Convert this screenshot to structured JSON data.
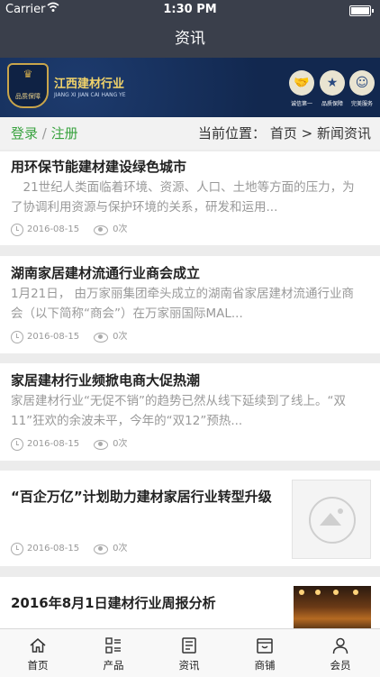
{
  "status_bar": {
    "carrier": "Carrier",
    "time": "1:30 PM"
  },
  "nav": {
    "title": "资讯"
  },
  "banner": {
    "shield_label": "品质保障",
    "brand_title": "江西建材行业",
    "brand_subtitle": "JIANG XI JIAN CAI HANG YE",
    "badges": [
      {
        "icon": "handshake-icon",
        "label": "诚信第一"
      },
      {
        "icon": "star-icon",
        "label": "品质保障"
      },
      {
        "icon": "service-person-icon",
        "label": "完美服务"
      }
    ]
  },
  "breadcrumb_bar": {
    "login": "登录",
    "separator": "/",
    "register": "注册",
    "location_prefix": "当前位置：",
    "home": "首页",
    "arrow": ">",
    "current": "新闻资讯"
  },
  "articles": [
    {
      "title": "用环保节能建材建设绿色城市",
      "summary": "　21世纪人类面临着环境、资源、人口、土地等方面的压力，为了协调利用资源与保护环境的关系，研发和运用...",
      "date": "2016-08-15",
      "views": "0次"
    },
    {
      "title": "湖南家居建材流通行业商会成立",
      "summary": "1月21日， 由万家丽集团牵头成立的湖南省家居建材流通行业商会（以下简称“商会”）在万家丽国际MAL...",
      "date": "2016-08-15",
      "views": "0次"
    },
    {
      "title": "家居建材行业频掀电商大促热潮",
      "summary": "家居建材行业“无促不销”的趋势已然从线下延续到了线上。“双11”狂欢的余波未平，今年的“双12”预热...",
      "date": "2016-08-15",
      "views": "0次"
    },
    {
      "title": "“百企万亿”计划助力建材家居行业转型升级",
      "date": "2016-08-15",
      "views": "0次"
    },
    {
      "title": "2016年8月1日建材行业周报分析"
    }
  ],
  "tab_bar": {
    "tabs": [
      {
        "label": "首页",
        "icon": "home-icon"
      },
      {
        "label": "产品",
        "icon": "list-icon"
      },
      {
        "label": "资讯",
        "icon": "news-icon"
      },
      {
        "label": "商铺",
        "icon": "shop-icon"
      },
      {
        "label": "会员",
        "icon": "user-icon"
      }
    ]
  }
}
